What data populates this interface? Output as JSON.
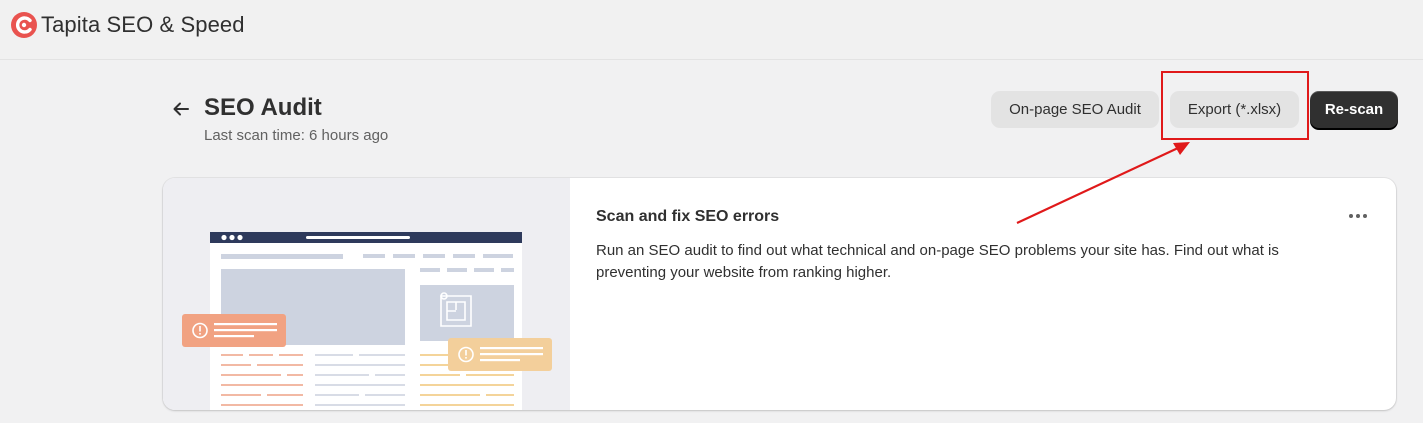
{
  "app": {
    "name": "Tapita SEO & Speed",
    "logo_icon": "tapita-logo-icon",
    "brand_color": "#e9534f"
  },
  "header": {
    "title": "SEO Audit",
    "subtitle": "Last scan time: 6 hours ago",
    "back_icon": "arrow-left-icon"
  },
  "actions": {
    "onpage_label": "On-page SEO Audit",
    "export_label": "Export (*.xlsx)",
    "rescan_label": "Re-scan"
  },
  "annotation": {
    "color": "#e0191a"
  },
  "card": {
    "title": "Scan and fix SEO errors",
    "body": "Run an SEO audit to find out what technical and on-page SEO problems your site has. Find out what is preventing your website from ranking higher.",
    "menu_icon": "more-horizontal-icon",
    "illustration_icon": "website-audit-illustration"
  }
}
